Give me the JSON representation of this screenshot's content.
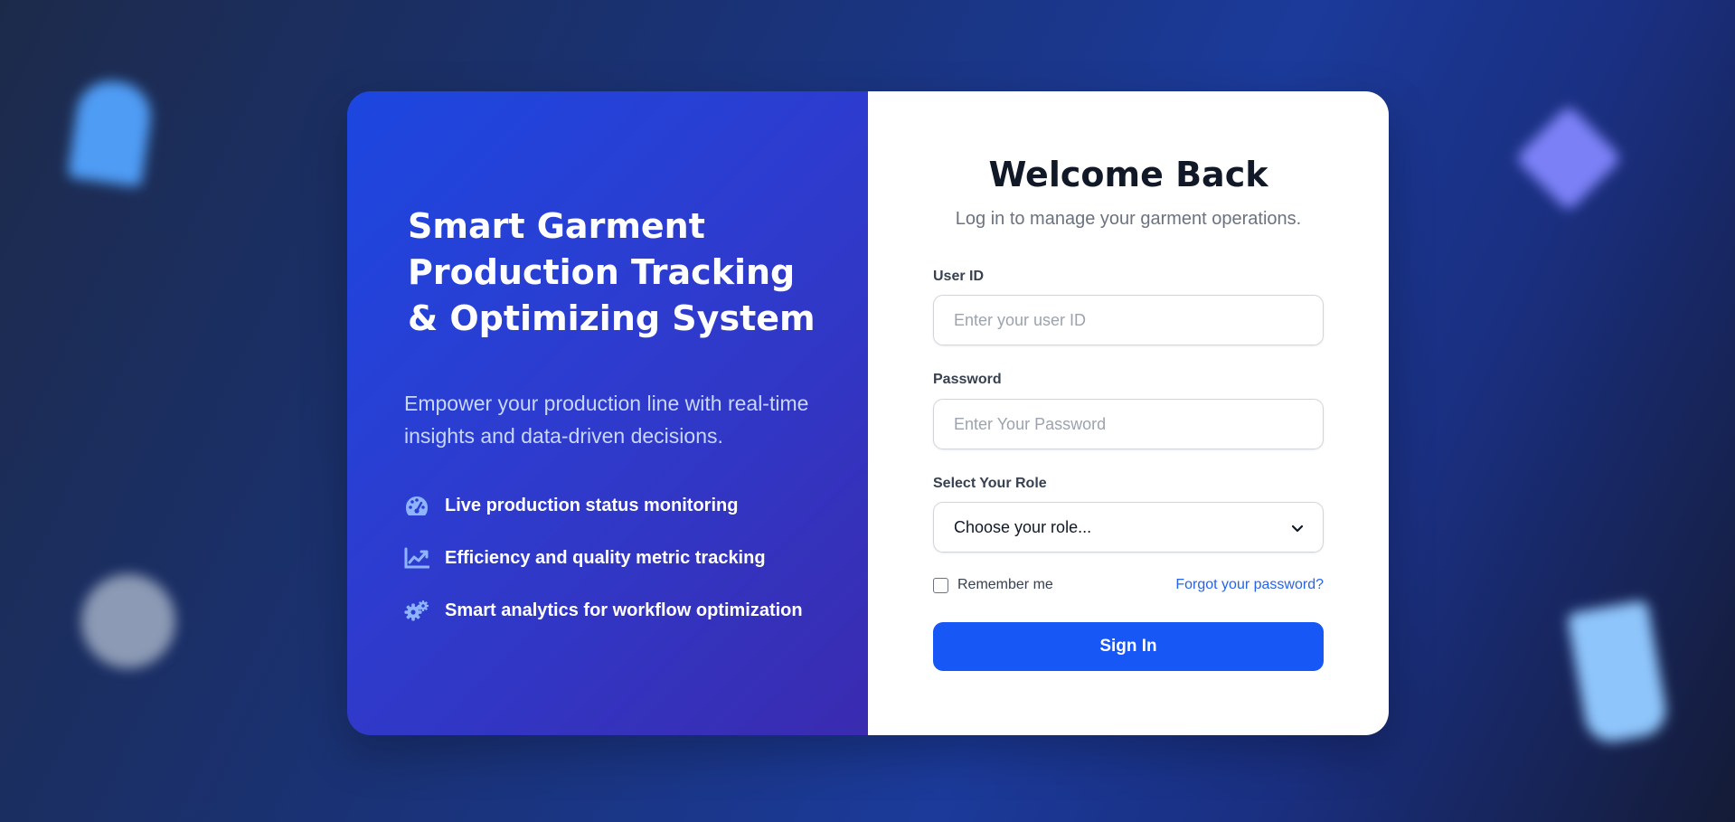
{
  "hero": {
    "title_lines": [
      "Smart Garment",
      "Production Tracking",
      "& Optimizing System"
    ],
    "subtitle": "Empower your production line with real-time insights and data-driven decisions.",
    "features": [
      {
        "icon": "gauge-icon",
        "label": "Live production status monitoring"
      },
      {
        "icon": "chart-line-icon",
        "label": "Efficiency and quality metric tracking"
      },
      {
        "icon": "gears-icon",
        "label": "Smart analytics for workflow optimization"
      }
    ]
  },
  "login": {
    "title": "Welcome Back",
    "subtitle": "Log in to manage your garment operations.",
    "user_id_label": "User ID",
    "user_id_placeholder": "Enter your user ID",
    "user_id_value": "",
    "password_label": "Password",
    "password_placeholder": "Enter Your Password",
    "password_value": "",
    "role_label": "Select Your Role",
    "role_selected": "Choose your role...",
    "remember_label": "Remember me",
    "remember_checked": false,
    "forgot_label": "Forgot your password?",
    "signin_label": "Sign In"
  },
  "colors": {
    "primary_button": "#1657f5",
    "link": "#2563eb",
    "icon_accent": "#8fb4ff"
  }
}
